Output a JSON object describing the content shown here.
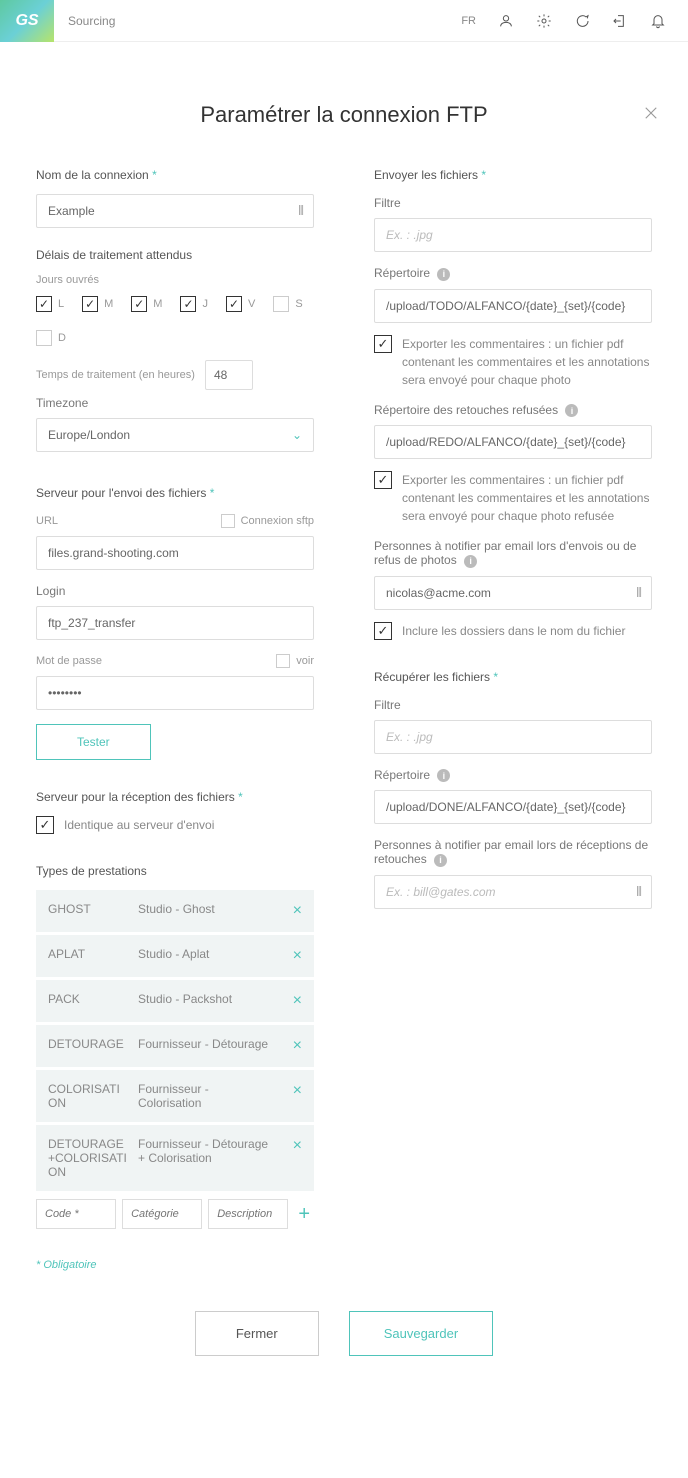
{
  "topbar": {
    "logo": "GS",
    "nav": "Sourcing",
    "lang": "FR"
  },
  "title": "Paramétrer la connexion FTP",
  "left": {
    "conn_name_label": "Nom de la connexion",
    "conn_name_value": "Example",
    "delay_label": "Délais de traitement attendus",
    "workdays_label": "Jours ouvrés",
    "days": [
      "L",
      "M",
      "M",
      "J",
      "V",
      "S",
      "D"
    ],
    "proc_time_label": "Temps de traitement (en heures)",
    "proc_time_value": "48",
    "timezone_label": "Timezone",
    "timezone_value": "Europe/London",
    "send_server_label": "Serveur pour l'envoi des fichiers",
    "url_label": "URL",
    "sftp_label": "Connexion sftp",
    "url_value": "files.grand-shooting.com",
    "login_label": "Login",
    "login_value": "ftp_237_transfer",
    "pwd_label": "Mot de passe",
    "pwd_show": "voir",
    "pwd_value": "••••••••",
    "test_btn": "Tester",
    "recv_server_label": "Serveur pour la réception des fichiers",
    "same_server": "Identique au serveur d'envoi",
    "prest_label": "Types de prestations",
    "prest": [
      {
        "code": "GHOST",
        "desc": "Studio - Ghost"
      },
      {
        "code": "APLAT",
        "desc": "Studio - Aplat"
      },
      {
        "code": "PACK",
        "desc": "Studio - Packshot"
      },
      {
        "code": "DETOURAGE",
        "desc": "Fournisseur - Détourage"
      },
      {
        "code": "COLORISATION",
        "desc": "Fournisseur - Colorisation"
      },
      {
        "code": "DETOURAGE+COLORISATION",
        "desc": "Fournisseur - Détourage + Colorisation"
      }
    ],
    "add_code_ph": "Code *",
    "add_cat_ph": "Catégorie",
    "add_desc_ph": "Description",
    "oblig": "* Obligatoire"
  },
  "right": {
    "send_label": "Envoyer les fichiers",
    "filter_label": "Filtre",
    "filter_ph": "Ex. : .jpg",
    "repo_label": "Répertoire",
    "send_repo": "/upload/TODO/ALFANCO/{date}_{set}/{code}",
    "export_comments": "Exporter les commentaires : un fichier pdf contenant les commentaires et les annotations sera envoyé pour chaque photo",
    "refused_repo_label": "Répertoire des retouches refusées",
    "refused_repo": "/upload/REDO/ALFANCO/{date}_{set}/{code}",
    "export_comments_refused": "Exporter les commentaires : un fichier pdf contenant les commentaires et les annotations sera envoyé pour chaque photo refusée",
    "notify_send_label": "Personnes à notifier par email lors d'envois ou de refus de photos",
    "notify_send_value": "nicolas@acme.com",
    "include_folders": "Inclure les dossiers dans le nom du fichier",
    "recv_label": "Récupérer les fichiers",
    "recv_repo": "/upload/DONE/ALFANCO/{date}_{set}/{code}",
    "notify_recv_label": "Personnes à notifier par email lors de réceptions de retouches",
    "notify_recv_ph": "Ex. : bill@gates.com"
  },
  "footer": {
    "close": "Fermer",
    "save": "Sauvegarder"
  }
}
